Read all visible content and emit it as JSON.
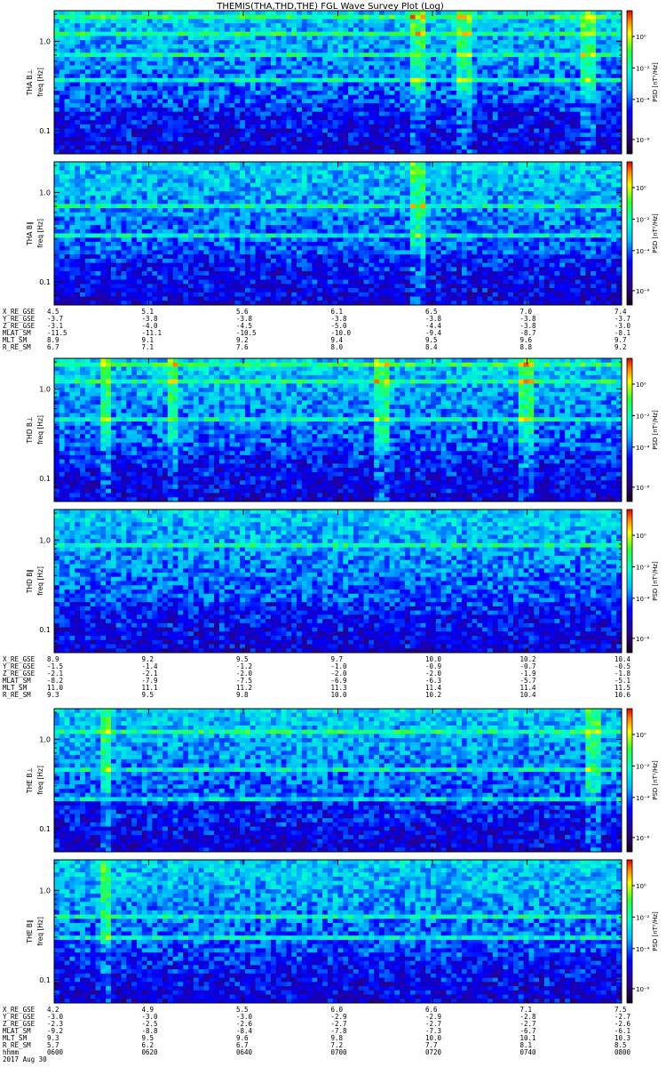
{
  "chart_data": {
    "type": "heatmap",
    "title": "THEMIS(THA,THD,THE) FGL Wave Survey Plot (Log)",
    "y_scale": "log",
    "y_ticks": [
      "1.0",
      "0.1"
    ],
    "colorbar_label": "PSD [nT²/Hz]",
    "colorbar_ticks": [
      "10⁰",
      "10⁻²",
      "10⁻⁴",
      "10⁻⁶"
    ],
    "time_axis": {
      "label": "hhmm",
      "date": "2017 Aug 30",
      "ticks": [
        "0600",
        "0620",
        "0640",
        "0700",
        "0720",
        "0740",
        "0800"
      ]
    },
    "groups": [
      {
        "probe": "THA",
        "panels": [
          {
            "name": "THA B⊥",
            "ylabel": "freq [Hz]",
            "bands_hz": [
              0.38,
              0.7,
              1.2,
              1.9
            ],
            "bursts_frac": [
              0.64,
              0.72,
              0.94
            ]
          },
          {
            "name": "THA B∥",
            "ylabel": "freq [Hz]",
            "bands_hz": [
              0.32,
              0.7
            ],
            "bursts_frac": [
              0.64
            ]
          }
        ],
        "ephemeris": [
          {
            "label": "X_RE_GSE",
            "values": [
              "4.5",
              "5.1",
              "5.6",
              "6.1",
              "6.5",
              "7.0",
              "7.4"
            ]
          },
          {
            "label": "Y_RE_GSE",
            "values": [
              "-3.7",
              "-3.8",
              "-3.8",
              "-3.8",
              "-3.8",
              "-3.8",
              "-3.7"
            ]
          },
          {
            "label": "Z_RE_GSE",
            "values": [
              "-3.1",
              "-4.0",
              "-4.5",
              "-5.0",
              "-4.4",
              "-3.8",
              "-3.0"
            ]
          },
          {
            "label": "MLAT_SM",
            "values": [
              "-11.5",
              "-11.1",
              "-10.5",
              "-10.0",
              "-9.4",
              "-8.7",
              "-8.1"
            ]
          },
          {
            "label": "MLT_SM",
            "values": [
              "8.9",
              "9.1",
              "9.2",
              "9.4",
              "9.5",
              "9.6",
              "9.7"
            ]
          },
          {
            "label": "R_RE_SM",
            "values": [
              "6.7",
              "7.1",
              "7.6",
              "8.0",
              "8.4",
              "8.8",
              "9.2"
            ]
          }
        ]
      },
      {
        "probe": "THD",
        "panels": [
          {
            "name": "THD B⊥",
            "ylabel": "freq [Hz]",
            "bands_hz": [
              0.45,
              1.2,
              1.9
            ],
            "bursts_frac": [
              0.09,
              0.21,
              0.58,
              0.83
            ]
          },
          {
            "name": "THD B∥",
            "ylabel": "freq [Hz]",
            "bands_hz": [
              0.9
            ],
            "bursts_frac": []
          }
        ],
        "ephemeris": [
          {
            "label": "X_RE_GSE",
            "values": [
              "8.9",
              "9.2",
              "9.5",
              "9.7",
              "10.0",
              "10.2",
              "10.4"
            ]
          },
          {
            "label": "Y_RE_GSE",
            "values": [
              "-1.5",
              "-1.4",
              "-1.2",
              "-1.0",
              "-0.9",
              "-0.7",
              "-0.5"
            ]
          },
          {
            "label": "Z_RE_GSE",
            "values": [
              "-2.1",
              "-2.1",
              "-2.0",
              "-2.0",
              "-2.0",
              "-1.9",
              "-1.8"
            ]
          },
          {
            "label": "MLAT_SM",
            "values": [
              "-8.2",
              "-7.9",
              "-7.5",
              "-6.9",
              "-6.3",
              "-5.7",
              "-5.1"
            ]
          },
          {
            "label": "MLT_SM",
            "values": [
              "11.0",
              "11.1",
              "11.2",
              "11.3",
              "11.4",
              "11.4",
              "11.5"
            ]
          },
          {
            "label": "R_RE_SM",
            "values": [
              "9.3",
              "9.5",
              "9.8",
              "10.0",
              "10.2",
              "10.4",
              "10.6"
            ]
          }
        ]
      },
      {
        "probe": "THE",
        "panels": [
          {
            "name": "THE B⊥",
            "ylabel": "freq [Hz]",
            "bands_hz": [
              0.45,
              0.22,
              1.2
            ],
            "bursts_frac": [
              0.09,
              0.95
            ]
          },
          {
            "name": "THE B∥",
            "ylabel": "freq [Hz]",
            "bands_hz": [
              0.5,
              0.3
            ],
            "bursts_frac": [
              0.09
            ]
          }
        ],
        "ephemeris": [
          {
            "label": "X_RE_GSE",
            "values": [
              "4.2",
              "4.9",
              "5.5",
              "6.0",
              "6.6",
              "7.1",
              "7.5"
            ]
          },
          {
            "label": "Y_RE_GSE",
            "values": [
              "-3.0",
              "-3.0",
              "-3.0",
              "-2.9",
              "-2.9",
              "-2.8",
              "-2.7"
            ]
          },
          {
            "label": "Z_RE_GSE",
            "values": [
              "-2.3",
              "-2.5",
              "-2.6",
              "-2.7",
              "-2.7",
              "-2.7",
              "-2.6"
            ]
          },
          {
            "label": "MLAT_SM",
            "values": [
              "-9.2",
              "-8.8",
              "-8.4",
              "-7.8",
              "-7.3",
              "-6.7",
              "-6.1"
            ]
          },
          {
            "label": "MLT_SM",
            "values": [
              "9.3",
              "9.5",
              "9.6",
              "9.8",
              "10.0",
              "10.1",
              "10.3"
            ]
          },
          {
            "label": "R_RE_SM",
            "values": [
              "5.7",
              "6.2",
              "6.7",
              "7.2",
              "7.7",
              "8.1",
              "8.5"
            ]
          }
        ]
      }
    ]
  }
}
